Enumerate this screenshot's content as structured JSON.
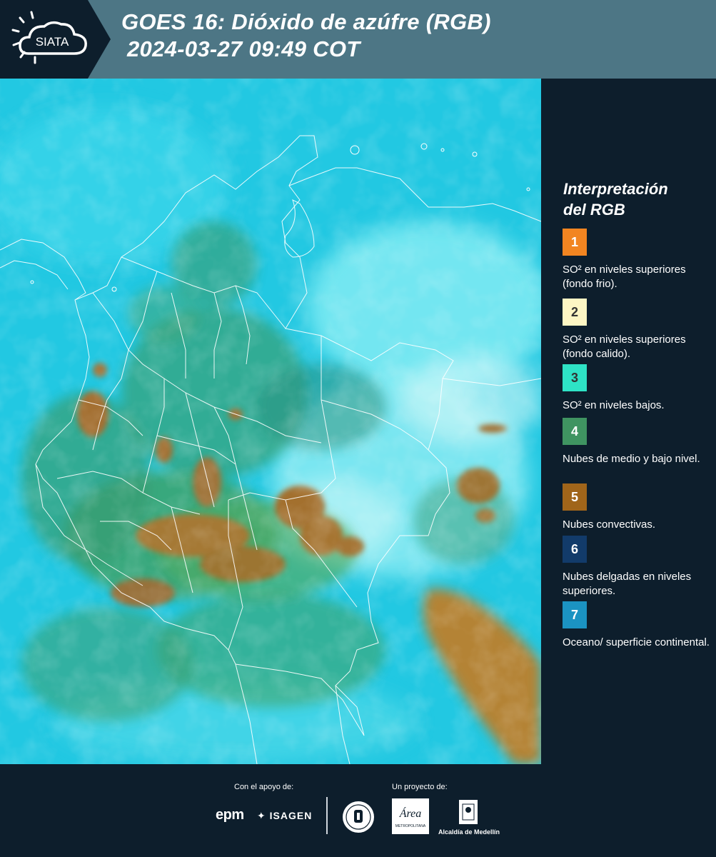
{
  "header": {
    "logo_text": "SIATA",
    "title_line1": "GOES 16: Dióxido de azúfre (RGB)",
    "title_line2": "2024-03-27 09:49 COT"
  },
  "map": {
    "description_icon": "satellite-rgb-map"
  },
  "legend": {
    "title_line1": "Interpretación",
    "title_line2": "del RGB",
    "items": [
      {
        "number": "1",
        "color": "#f28521",
        "desc": "SO² en niveles superiores (fondo frio)."
      },
      {
        "number": "2",
        "color": "#fdf6c4",
        "desc": "SO² en niveles superiores (fondo calido)."
      },
      {
        "number": "3",
        "color": "#2ee3c6",
        "desc": "SO² en niveles bajos."
      },
      {
        "number": "4",
        "color": "#3f9461",
        "desc": "Nubes de medio y bajo nivel."
      },
      {
        "number": "5",
        "color": "#a0651a",
        "desc": "Nubes convectivas."
      },
      {
        "number": "6",
        "color": "#123b6a",
        "desc": "Nubes delgadas en niveles superiores."
      },
      {
        "number": "7",
        "color": "#1b93c2",
        "desc": "Oceano/ superficie continental."
      }
    ]
  },
  "footer": {
    "support_label": "Con el apoyo de:",
    "project_label": "Un proyecto de:",
    "epm": "epm",
    "isagen": "ISAGEN",
    "amva_text": "Área",
    "amva_sub": "METROPOLITANA",
    "alcaldia": "Alcaldía de Medellín"
  }
}
